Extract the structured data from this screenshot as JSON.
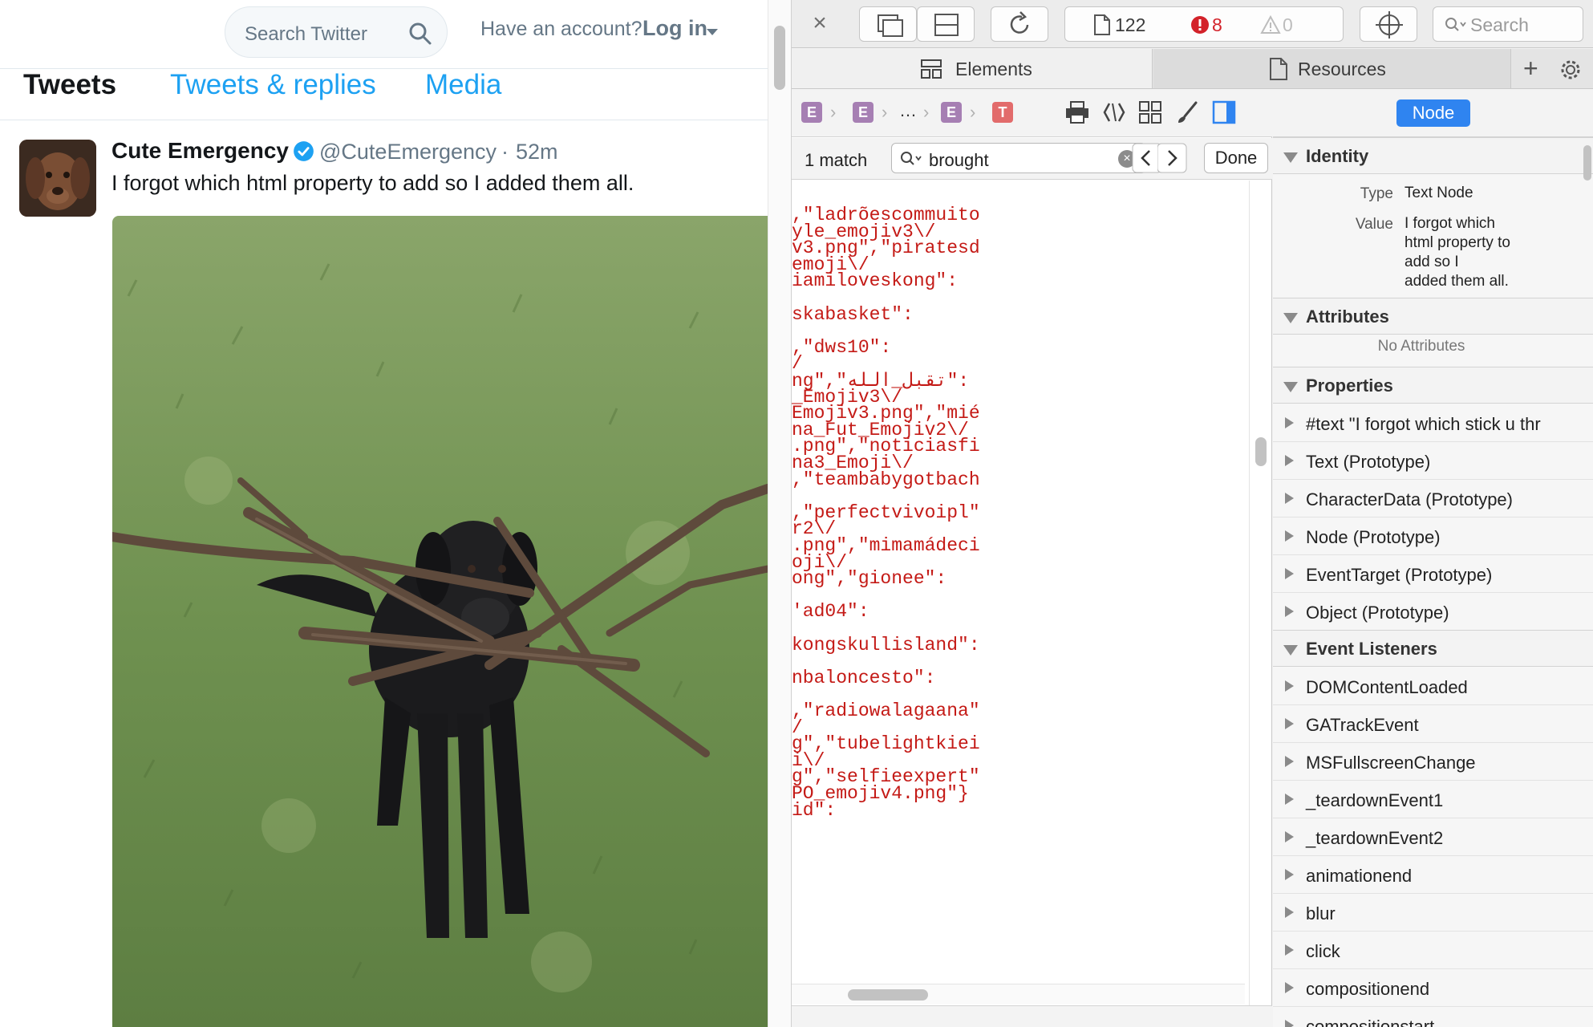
{
  "twitter": {
    "search_placeholder": "Search Twitter",
    "account_prompt": "Have an account?",
    "login_label": "Log in",
    "tabs": [
      "Tweets",
      "Tweets & replies",
      "Media"
    ],
    "tweet": {
      "name": "Cute Emergency",
      "handle": "@CuteEmergency",
      "separator": "·",
      "time": "52m",
      "text": "I forgot which html property to add so I added them all."
    }
  },
  "inspector": {
    "toolbar": {
      "doc_count": "122",
      "error_count": "8",
      "warning_count": "0",
      "search_placeholder": "Search"
    },
    "tabs": [
      "Elements",
      "Resources"
    ],
    "breadcrumb": {
      "badges": [
        "E",
        "E",
        "E",
        "T"
      ],
      "ellipsis": "…"
    },
    "find": {
      "matches": "1 match",
      "query": "brought",
      "done_label": "Done"
    },
    "code_lines": [
      ",\"ladrõescommuito",
      "yle_emojiv3\\/",
      "v3.png\",\"piratesd",
      "emoji\\/",
      "iamiloveskong\":",
      "",
      "skabasket\":",
      "",
      ",\"dws10\":",
      "/",
      "ng\",\"تقبل_الله\":",
      "_Emojiv3\\/",
      "Emojiv3.png\",\"mié",
      "na_Fut_Emojiv2\\/",
      ".png\",\"noticiasfi",
      "na3_Emoji\\/",
      ",\"teambabygotbach",
      "",
      ",\"perfectvivoipl\"",
      "r2\\/",
      ".png\",\"mimamádeci",
      "oji\\/",
      "ong\",\"gionee\":",
      "",
      "'ad04\":",
      "",
      "kongskullisland\":",
      "",
      "nbaloncesto\":",
      "",
      ",\"radiowalagaana\"",
      "/",
      "g\",\"tubelightkiei",
      "i\\/",
      "g\",\"selfieexpert\"",
      "PO_emojiv4.png\"}",
      "id\":"
    ],
    "sidebar": {
      "segment_label": "Node",
      "identity": {
        "title": "Identity",
        "type_key": "Type",
        "type_value": "Text Node",
        "value_key": "Value",
        "value_lines": [
          "I forgot which",
          "html property to",
          "add so I",
          "added them all."
        ]
      },
      "attributes": {
        "title": "Attributes",
        "empty": "No Attributes"
      },
      "properties": {
        "title": "Properties",
        "items": [
          "#text \"I forgot which stick u thr",
          "Text (Prototype)",
          "CharacterData (Prototype)",
          "Node (Prototype)",
          "EventTarget (Prototype)",
          "Object (Prototype)"
        ]
      },
      "event_listeners": {
        "title": "Event Listeners",
        "items": [
          "DOMContentLoaded",
          "GATrackEvent",
          "MSFullscreenChange",
          "_teardownEvent1",
          "_teardownEvent2",
          "animationend",
          "blur",
          "click",
          "compositionend",
          "compositionstart"
        ]
      }
    }
  },
  "colors": {
    "twitter_blue": "#1da1f2",
    "code_red": "#c41a16",
    "node_button_blue": "#2f84f0",
    "error_red": "#d3222a"
  }
}
